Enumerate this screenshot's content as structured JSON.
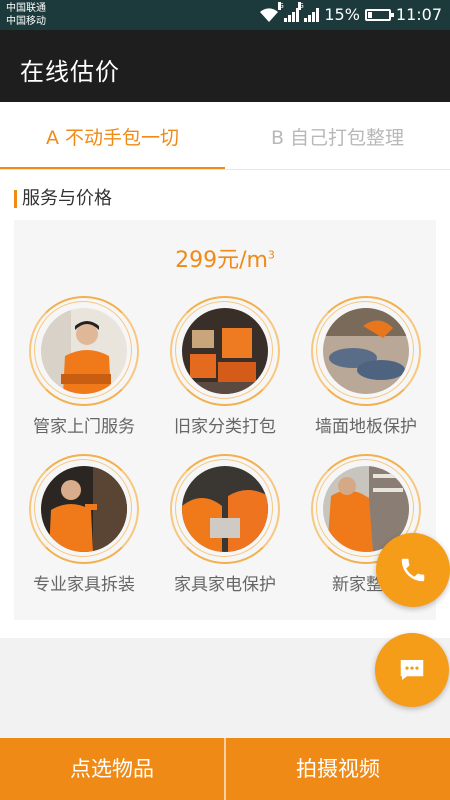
{
  "status_bar": {
    "carrier_1": "中国联通",
    "carrier_2": "中国移动",
    "network_1": "G",
    "network_2": "G",
    "battery": "15%",
    "time": "11:07"
  },
  "header": {
    "title": "在线估价"
  },
  "tabs": [
    {
      "label": "A 不动手包一切",
      "active": true
    },
    {
      "label": "B 自己打包整理",
      "active": false
    }
  ],
  "section": {
    "title": "服务与价格"
  },
  "price": {
    "amount": "299",
    "unit": "元/m",
    "unit_sup": "3"
  },
  "services": [
    {
      "label": "管家上门服务",
      "icon": "butler-photo"
    },
    {
      "label": "旧家分类打包",
      "icon": "packing-photo"
    },
    {
      "label": "墙面地板保护",
      "icon": "floor-protection-photo"
    },
    {
      "label": "专业家具拆装",
      "icon": "furniture-assembly-photo"
    },
    {
      "label": "家具家电保护",
      "icon": "appliance-protection-photo"
    },
    {
      "label": "新家整理",
      "icon": "new-home-arranging-photo"
    }
  ],
  "bottom_buttons": {
    "left": "点选物品",
    "right": "拍摄视频"
  },
  "colors": {
    "accent": "#f08a16",
    "status_bar": "#1c3a3c",
    "title_bar": "#1e1e1e"
  }
}
